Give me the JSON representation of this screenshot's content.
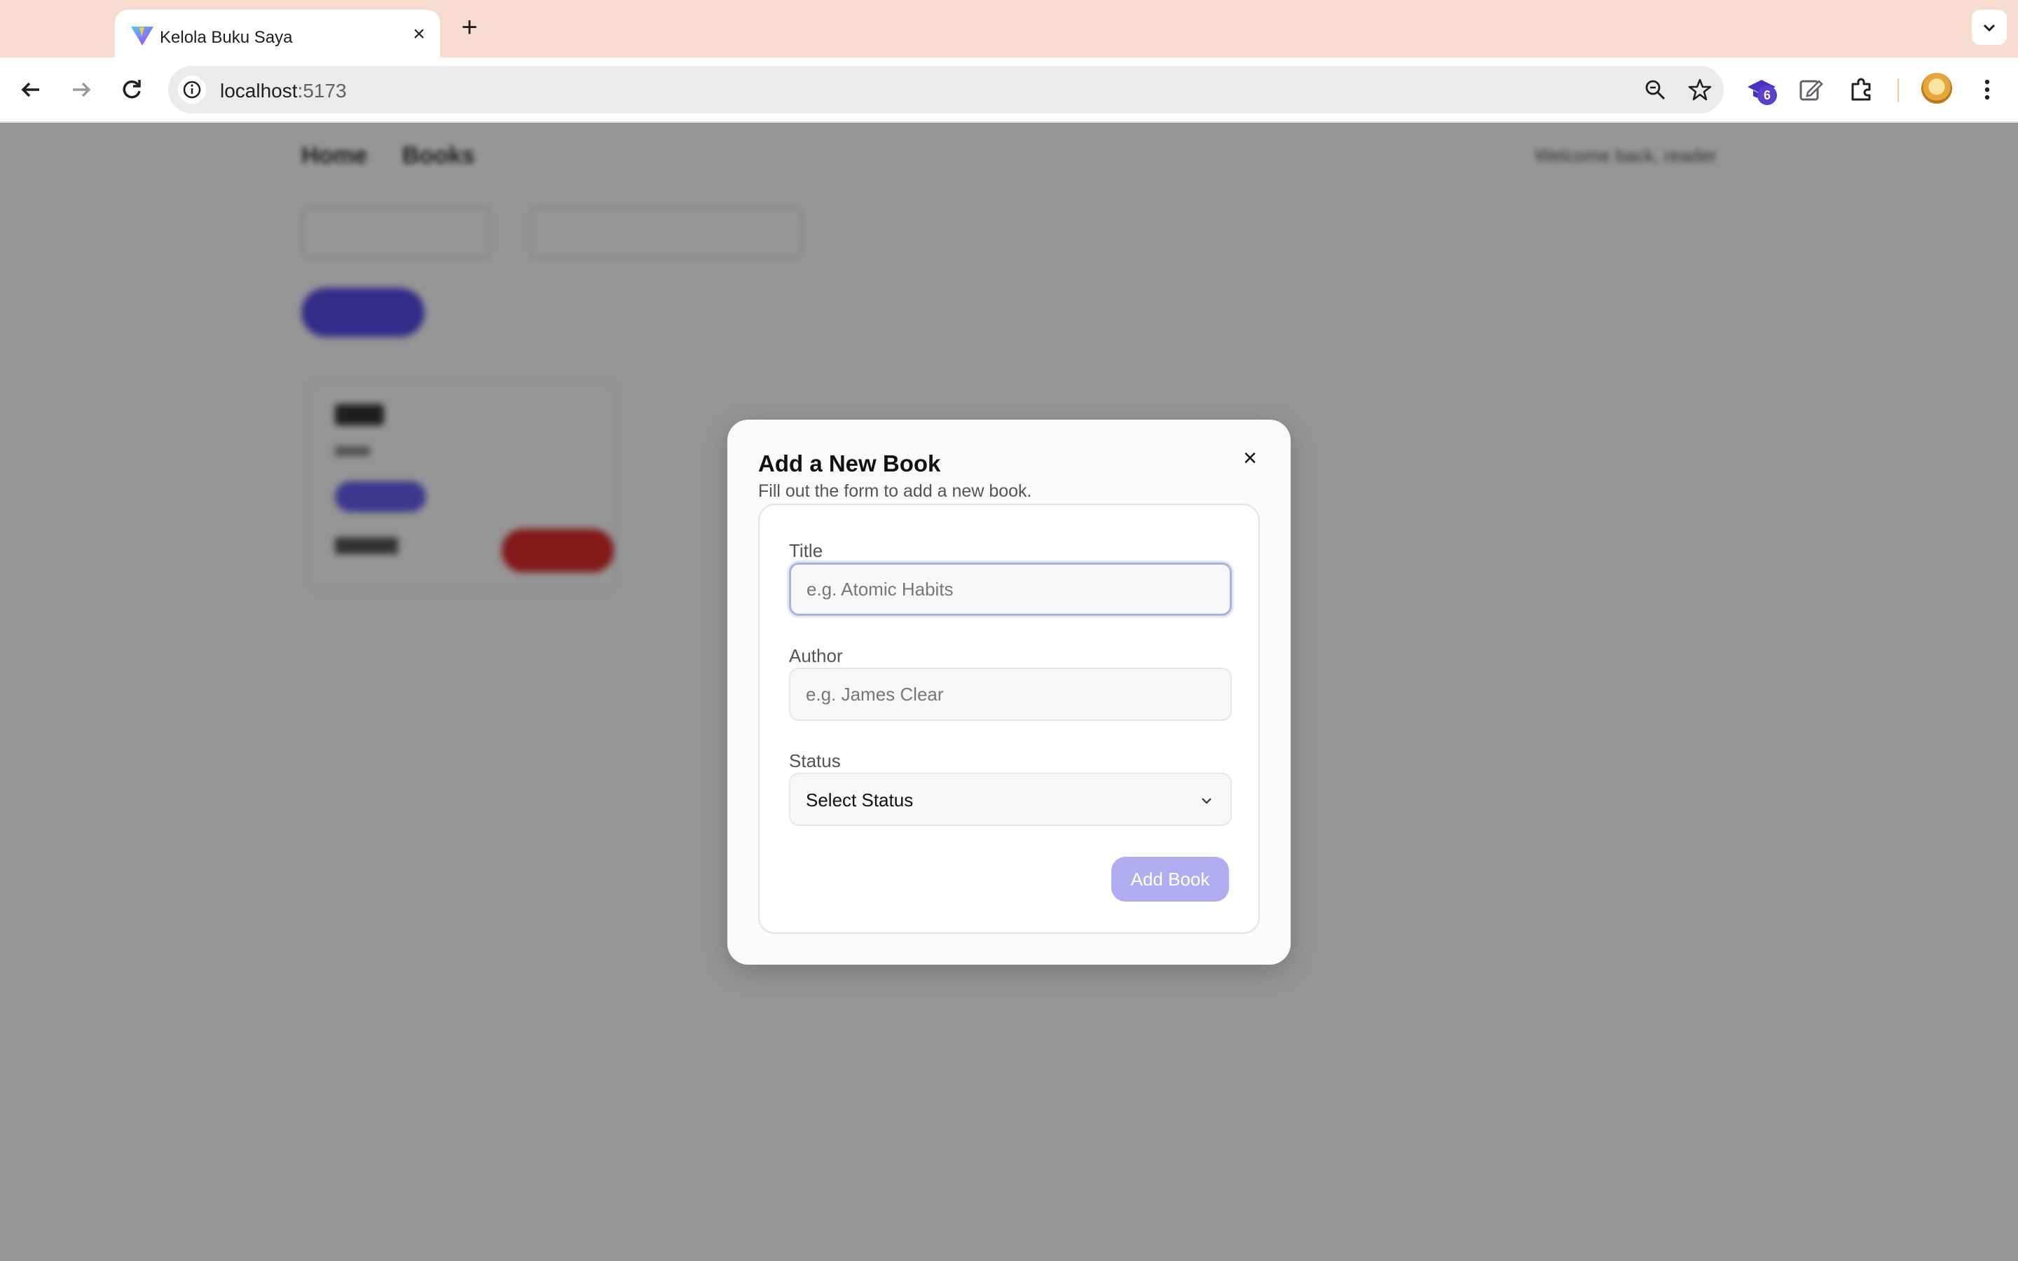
{
  "browser": {
    "tab_title": "Kelola Buku Saya",
    "url_host": "localhost",
    "url_port": ":5173",
    "extension_badge": "6"
  },
  "page": {
    "nav_items": [
      "Home",
      "Books"
    ],
    "user_text": "Welcome back, reader"
  },
  "modal": {
    "title": "Add a New Book",
    "subtitle": "Fill out the form to add a new book.",
    "fields": {
      "title_label": "Title",
      "title_placeholder": "e.g. Atomic Habits",
      "author_label": "Author",
      "author_placeholder": "e.g. James Clear",
      "status_label": "Status",
      "status_value": "Select Status"
    },
    "submit_label": "Add Book"
  },
  "colors": {
    "tabstrip": "#f8dccf",
    "submit_disabled": "#b2acf0",
    "accent": "#5b49e8"
  }
}
